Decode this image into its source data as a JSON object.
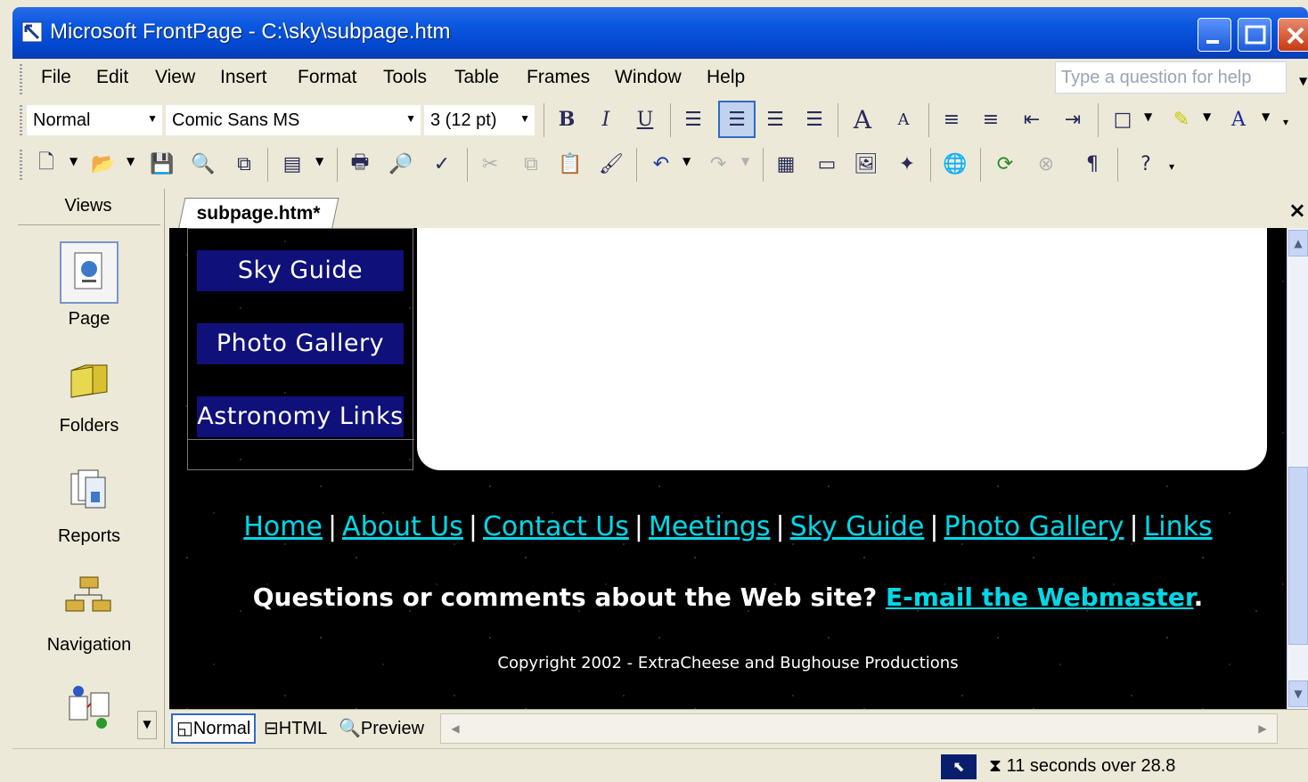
{
  "window": {
    "title": "Microsoft FrontPage - C:\\sky\\subpage.htm",
    "titlebar_color": "#0a58e0"
  },
  "menu": {
    "items": [
      "File",
      "Edit",
      "View",
      "Insert",
      "Format",
      "Tools",
      "Table",
      "Frames",
      "Window",
      "Help"
    ],
    "help_placeholder": "Type a question for help"
  },
  "formatting": {
    "style": "Normal",
    "font": "Comic Sans MS",
    "size": "3  (12 pt)"
  },
  "views": {
    "header": "Views",
    "items": [
      {
        "label": "Page",
        "icon": "page-view-icon"
      },
      {
        "label": "Folders",
        "icon": "folders-view-icon"
      },
      {
        "label": "Reports",
        "icon": "reports-view-icon"
      },
      {
        "label": "Navigation",
        "icon": "navigation-view-icon"
      },
      {
        "label": "",
        "icon": "hyperlinks-view-icon"
      }
    ]
  },
  "document": {
    "tab_label": "subpage.htm*",
    "nav_buttons": [
      "Sky Guide",
      "Photo Gallery",
      "Astronomy Links"
    ],
    "footer_links": [
      "Home",
      "About Us",
      "Contact Us",
      "Meetings",
      "Sky Guide",
      "Photo Gallery",
      "Links"
    ],
    "questions_text": "Questions or comments about the Web site?",
    "webmaster_link": "E-mail the Webmaster",
    "period": ".",
    "copyright": "Copyright 2002 - ExtraCheese and Bughouse Productions",
    "link_color": "#00d8e8",
    "nav_button_color": "#10107a"
  },
  "view_tabs": {
    "normal": "Normal",
    "html": "HTML",
    "preview": "Preview"
  },
  "status": {
    "download_time": "11 seconds over 28.8"
  }
}
